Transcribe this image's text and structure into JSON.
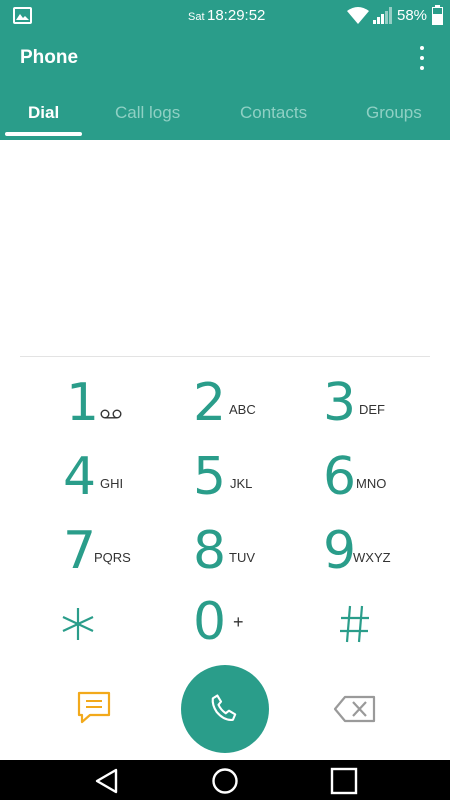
{
  "statusbar": {
    "day": "Sat",
    "time": "18:29:52",
    "battery": "58%"
  },
  "appbar": {
    "title": "Phone",
    "tabs": [
      {
        "label": "Dial",
        "active": true
      },
      {
        "label": "Call logs",
        "active": false
      },
      {
        "label": "Contacts",
        "active": false
      },
      {
        "label": "Groups",
        "active": false
      }
    ]
  },
  "dialpad": {
    "keys": [
      {
        "digit": "1",
        "letters": ""
      },
      {
        "digit": "2",
        "letters": "ABC"
      },
      {
        "digit": "3",
        "letters": "DEF"
      },
      {
        "digit": "4",
        "letters": "GHI"
      },
      {
        "digit": "5",
        "letters": "JKL"
      },
      {
        "digit": "6",
        "letters": "MNO"
      },
      {
        "digit": "7",
        "letters": "PQRS"
      },
      {
        "digit": "8",
        "letters": "TUV"
      },
      {
        "digit": "9",
        "letters": "WXYZ"
      },
      {
        "digit": "*",
        "letters": ""
      },
      {
        "digit": "0",
        "letters": "+"
      },
      {
        "digit": "#",
        "letters": ""
      }
    ]
  },
  "actions": {
    "message_icon": "message-icon",
    "call_icon": "phone-icon",
    "delete_icon": "backspace-icon"
  },
  "colors": {
    "accent": "#2a9d8a",
    "message": "#f2a91b"
  }
}
